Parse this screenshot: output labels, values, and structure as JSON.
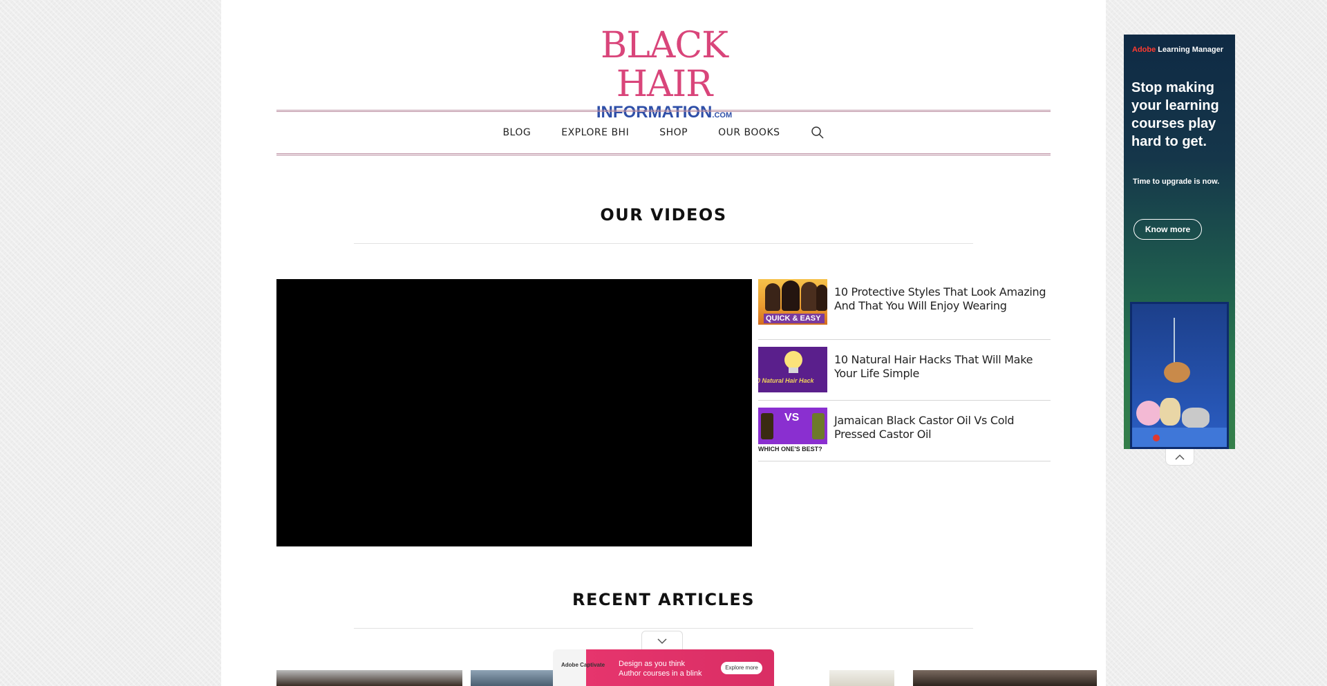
{
  "logo": {
    "line1": "BLACK HAIR",
    "line2": "INFORMATION",
    "suffix": ".COM"
  },
  "nav": {
    "items": [
      "BLOG",
      "EXPLORE BHI",
      "SHOP",
      "OUR BOOKS"
    ]
  },
  "videos_section": {
    "title": "OUR VIDEOS",
    "items": [
      {
        "title": "10 Protective Styles That Look Amazing And That You Will Enjoy Wearing",
        "thumb_label": "QUICK & EASY"
      },
      {
        "title": "10 Natural Hair Hacks That Will Make Your Life Simple",
        "thumb_label": "0 Natural Hair Hack"
      },
      {
        "title": "Jamaican Black Castor Oil Vs Cold Pressed Castor Oil",
        "thumb_label": "WHICH ONE'S BEST?",
        "thumb_badge": "VS"
      }
    ]
  },
  "articles_section": {
    "title": "RECENT ARTICLES"
  },
  "side_ad": {
    "brand_red": "Adobe",
    "brand": "Learning Manager",
    "headline": "Stop making your learning courses play hard to get.",
    "sub": "Time to upgrade is now.",
    "button": "Know more"
  },
  "bottom_ad": {
    "logo": "Adobe Captivate",
    "line1": "Design as you think",
    "line2": "Author courses in a blink",
    "button": "Explore more"
  },
  "colors": {
    "logo_pink": "#d9457a",
    "logo_blue": "#2e4fa8",
    "nav_rule": "#b98b9e"
  }
}
